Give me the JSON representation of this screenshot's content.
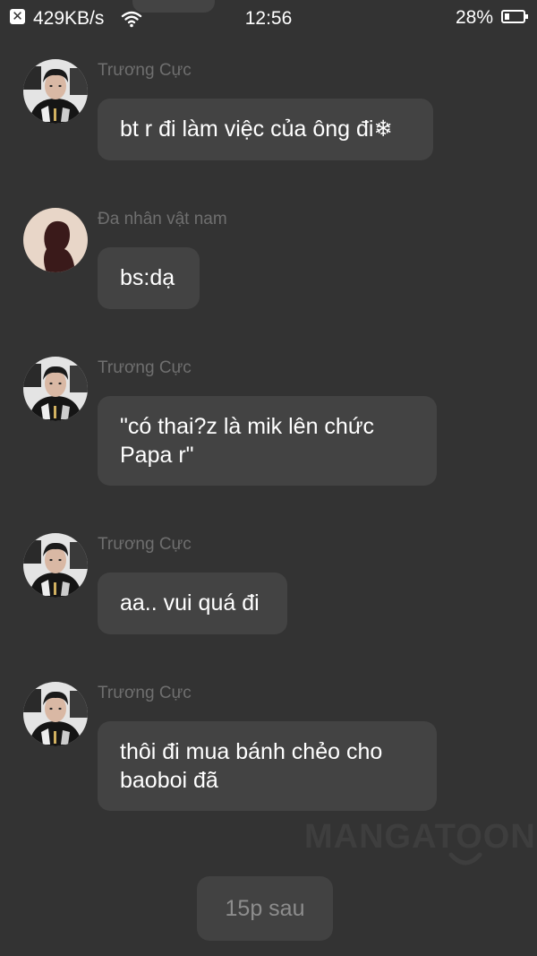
{
  "status_bar": {
    "close_glyph": "✕",
    "network_speed": "429KB/s",
    "time": "12:56",
    "battery_percent": "28%",
    "battery_level": 0.28,
    "wifi_icon": "wifi-icon"
  },
  "messages": [
    {
      "sender": "Trương Cực",
      "avatar": "avatar-photo",
      "lines": [
        "bt r đi làm việc của ông đi❄"
      ]
    },
    {
      "sender": "Đa nhân vật nam",
      "avatar": "avatar-silhouette",
      "lines": [
        "bs:dạ"
      ]
    },
    {
      "sender": "Trương Cực",
      "avatar": "avatar-photo",
      "lines": [
        "\"có thai?z là mik lên chức",
        "Papa r\""
      ]
    },
    {
      "sender": "Trương Cực",
      "avatar": "avatar-photo",
      "lines": [
        "aa.. vui quá đi"
      ]
    },
    {
      "sender": "Trương Cực",
      "avatar": "avatar-photo",
      "lines": [
        "thôi đi mua bánh chẻo cho",
        "baoboi đã"
      ]
    }
  ],
  "watermark": {
    "text": "MANGATOON"
  },
  "time_divider": {
    "label": "15p sau"
  },
  "colors": {
    "background": "#333333",
    "bubble": "#434343",
    "sender_name": "#6f6f6f",
    "text": "#ffffff",
    "silhouette_bg": "#e8d6c8",
    "silhouette_figure": "#3a1a1a"
  }
}
